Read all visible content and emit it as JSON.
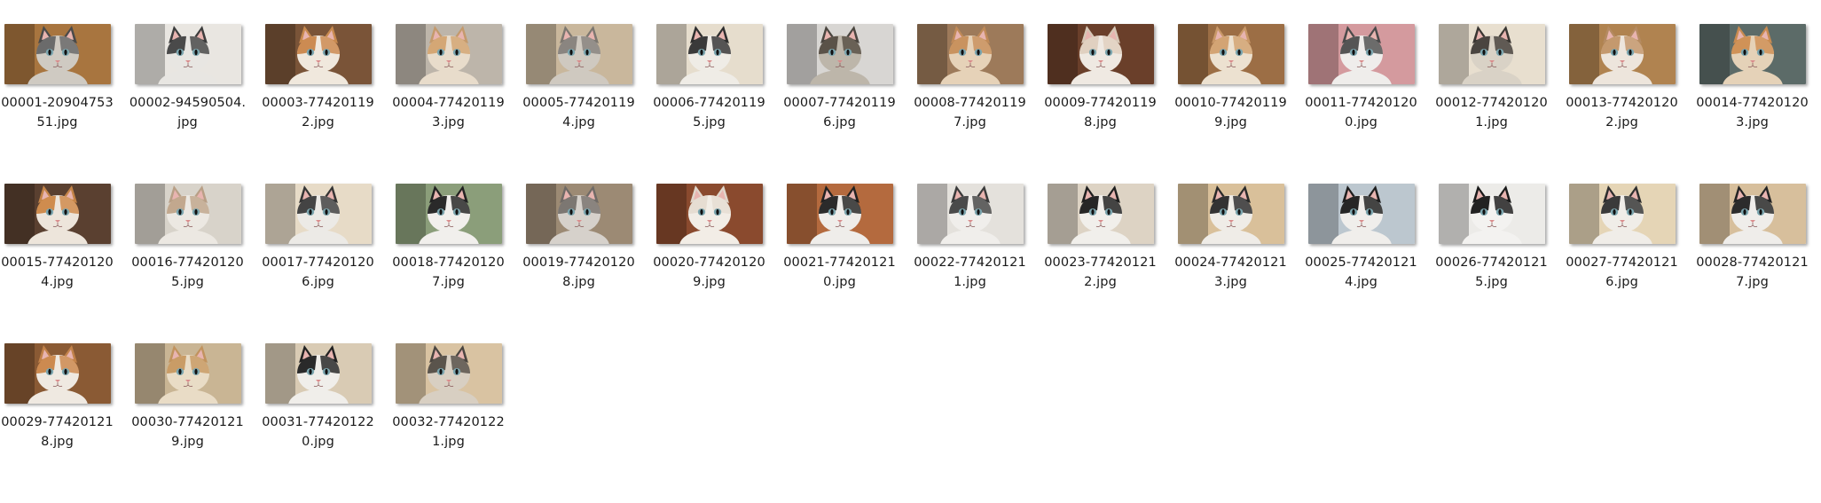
{
  "files": [
    {
      "line1": "00001-20904753",
      "line2": "51.jpg",
      "bg": "#a8753f",
      "fur": "#cfcac2",
      "ear": "#4a4a4a",
      "patch": "#6b6b6b"
    },
    {
      "line1": "00002-94590504.",
      "line2": "jpg",
      "bg": "#e9e6e1",
      "fur": "#e8e6e2",
      "ear": "#3d3d3d",
      "patch": "#4a4a4a"
    },
    {
      "line1": "00003-77420119",
      "line2": "2.jpg",
      "bg": "#7a5438",
      "fur": "#f0e8dd",
      "ear": "#c88a4f",
      "patch": "#cc8b52"
    },
    {
      "line1": "00004-77420119",
      "line2": "3.jpg",
      "bg": "#bdb5aa",
      "fur": "#e8dccb",
      "ear": "#c49a6c",
      "patch": "#d4a775"
    },
    {
      "line1": "00005-77420119",
      "line2": "4.jpg",
      "bg": "#c9b79c",
      "fur": "#cfc9c0",
      "ear": "#7c7770",
      "patch": "#8a8580"
    },
    {
      "line1": "00006-77420119",
      "line2": "5.jpg",
      "bg": "#e6ddcd",
      "fur": "#efece6",
      "ear": "#2e2e2e",
      "patch": "#3a3a3a"
    },
    {
      "line1": "00007-77420119",
      "line2": "6.jpg",
      "bg": "#d8d6d3",
      "fur": "#bdb6aa",
      "ear": "#4b4640",
      "patch": "#5a5248"
    },
    {
      "line1": "00008-77420119",
      "line2": "7.jpg",
      "bg": "#9d7a5a",
      "fur": "#e6d2b8",
      "ear": "#c08a58",
      "patch": "#c9935f"
    },
    {
      "line1": "00009-77420119",
      "line2": "8.jpg",
      "bg": "#6a3f2a",
      "fur": "#efe9e2",
      "ear": "#d7c7b6",
      "patch": "#e0d0c0"
    },
    {
      "line1": "00010-77420119",
      "line2": "9.jpg",
      "bg": "#9c6e45",
      "fur": "#ece1d0",
      "ear": "#c99868",
      "patch": "#d3a474"
    },
    {
      "line1": "00011-77420120",
      "line2": "0.jpg",
      "bg": "#d49a9e",
      "fur": "#efedeb",
      "ear": "#4a4a4a",
      "patch": "#555555"
    },
    {
      "line1": "00012-77420120",
      "line2": "1.jpg",
      "bg": "#e8dfcf",
      "fur": "#d9d2c6",
      "ear": "#3a3632",
      "patch": "#4a4540"
    },
    {
      "line1": "00013-77420120",
      "line2": "2.jpg",
      "bg": "#b08350",
      "fur": "#ede5dc",
      "ear": "#b58b62",
      "patch": "#c4996e"
    },
    {
      "line1": "00014-77420120",
      "line2": "3.jpg",
      "bg": "#5c6b68",
      "fur": "#e5d2b8",
      "ear": "#c98b50",
      "patch": "#d09257"
    },
    {
      "line1": "00015-77420120",
      "line2": "4.jpg",
      "bg": "#5a4030",
      "fur": "#ede5db",
      "ear": "#c48448",
      "patch": "#cf8c4e"
    },
    {
      "line1": "00016-77420120",
      "line2": "5.jpg",
      "bg": "#d8d3ca",
      "fur": "#ece8e2",
      "ear": "#b89f86",
      "patch": "#c2a88e"
    },
    {
      "line1": "00017-77420120",
      "line2": "6.jpg",
      "bg": "#e7dbc7",
      "fur": "#eceae6",
      "ear": "#353535",
      "patch": "#444444"
    },
    {
      "line1": "00018-77420120",
      "line2": "7.jpg",
      "bg": "#8b9e7a",
      "fur": "#f1efec",
      "ear": "#222222",
      "patch": "#2a2a2a"
    },
    {
      "line1": "00019-77420120",
      "line2": "8.jpg",
      "bg": "#9c8a74",
      "fur": "#d6d1cb",
      "ear": "#6f6a66",
      "patch": "#7c7772"
    },
    {
      "line1": "00020-77420120",
      "line2": "9.jpg",
      "bg": "#8a4a2e",
      "fur": "#f2ede6",
      "ear": "#e0d6cb",
      "patch": "#e6ddd2"
    },
    {
      "line1": "00021-77420121",
      "line2": "0.jpg",
      "bg": "#b46a3e",
      "fur": "#efedea",
      "ear": "#222222",
      "patch": "#2b2b2b"
    },
    {
      "line1": "00022-77420121",
      "line2": "1.jpg",
      "bg": "#e4e1dc",
      "fur": "#f0eeeb",
      "ear": "#3a3a3a",
      "patch": "#4a4a4a"
    },
    {
      "line1": "00023-77420121",
      "line2": "2.jpg",
      "bg": "#ddd3c4",
      "fur": "#f1efeb",
      "ear": "#1f1f1f",
      "patch": "#262626"
    },
    {
      "line1": "00024-77420121",
      "line2": "3.jpg",
      "bg": "#d9c09a",
      "fur": "#efece7",
      "ear": "#2a2a2a",
      "patch": "#333333"
    },
    {
      "line1": "00025-77420121",
      "line2": "4.jpg",
      "bg": "#bcc7cf",
      "fur": "#f0eeeb",
      "ear": "#1e1e1e",
      "patch": "#262626"
    },
    {
      "line1": "00026-77420121",
      "line2": "5.jpg",
      "bg": "#ecebe8",
      "fur": "#f3f2f0",
      "ear": "#1a1a1a",
      "patch": "#222222"
    },
    {
      "line1": "00027-77420121",
      "line2": "6.jpg",
      "bg": "#e5d5b6",
      "fur": "#f0ede8",
      "ear": "#2e2e2e",
      "patch": "#3a3a3a"
    },
    {
      "line1": "00028-77420121",
      "line2": "7.jpg",
      "bg": "#d7bf9c",
      "fur": "#efedea",
      "ear": "#242424",
      "patch": "#2c2c2c"
    },
    {
      "line1": "00029-77420121",
      "line2": "8.jpg",
      "bg": "#8a5a34",
      "fur": "#efe9e1",
      "ear": "#c2824a",
      "patch": "#cc8a50"
    },
    {
      "line1": "00030-77420121",
      "line2": "9.jpg",
      "bg": "#c9b594",
      "fur": "#e9dcc6",
      "ear": "#c1935e",
      "patch": "#c99c66"
    },
    {
      "line1": "00031-77420122",
      "line2": "0.jpg",
      "bg": "#d9cbb4",
      "fur": "#f0eeea",
      "ear": "#222222",
      "patch": "#2a2a2a"
    },
    {
      "line1": "00032-77420122",
      "line2": "1.jpg",
      "bg": "#d9c3a2",
      "fur": "#d8cfc2",
      "ear": "#4a4540",
      "patch": "#5a544c"
    }
  ]
}
